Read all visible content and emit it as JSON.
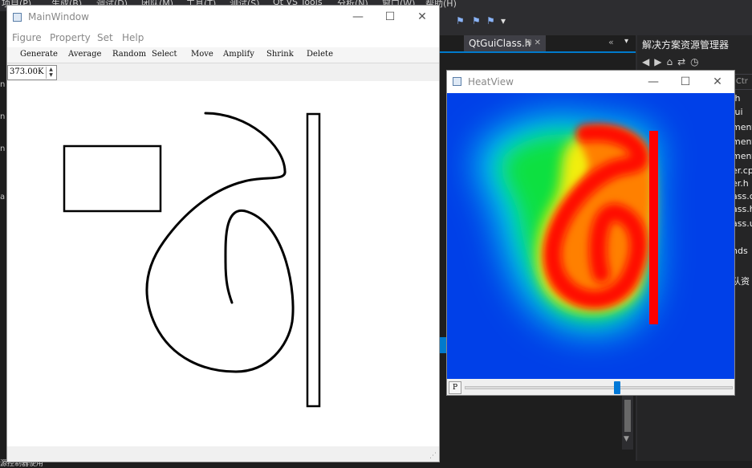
{
  "ide": {
    "menu": [
      "项目(P)",
      "生成(B)",
      "调试(D)",
      "团队(M)",
      "工具(T)",
      "测试(S)",
      "Qt VS Tools",
      "分析(N)",
      "窗口(W)",
      "帮助(H)"
    ],
    "editor_tab": "QtGuiClass.h",
    "editor_tab_icons": "⊞ ✕",
    "solution_explorer_title": "解决方案资源管理器",
    "search_hint": "(Ctr",
    "files": [
      ".h",
      ".ui",
      "ment",
      "ment",
      "ment",
      "er.cp",
      "er.h",
      "ass.c",
      "ass.h",
      "ass.u",
      "nds",
      "队资"
    ],
    "status_text": "源控制器使用"
  },
  "main_window": {
    "title": "MainWindow",
    "menu": [
      "Figure",
      "Property",
      "Set",
      "Help"
    ],
    "toolbar": [
      "Generate",
      "Average",
      "Random",
      "Select",
      "Move",
      "Amplify",
      "Shrink",
      "Delete"
    ],
    "spin_value": "373.00K"
  },
  "heat_view": {
    "title": "HeatView",
    "p_button": "P",
    "slider_value": 0.57
  },
  "colors": {
    "ide_bg": "#2d2d30",
    "heat_bar": "#ff0000",
    "slider_handle": "#0078d7"
  }
}
